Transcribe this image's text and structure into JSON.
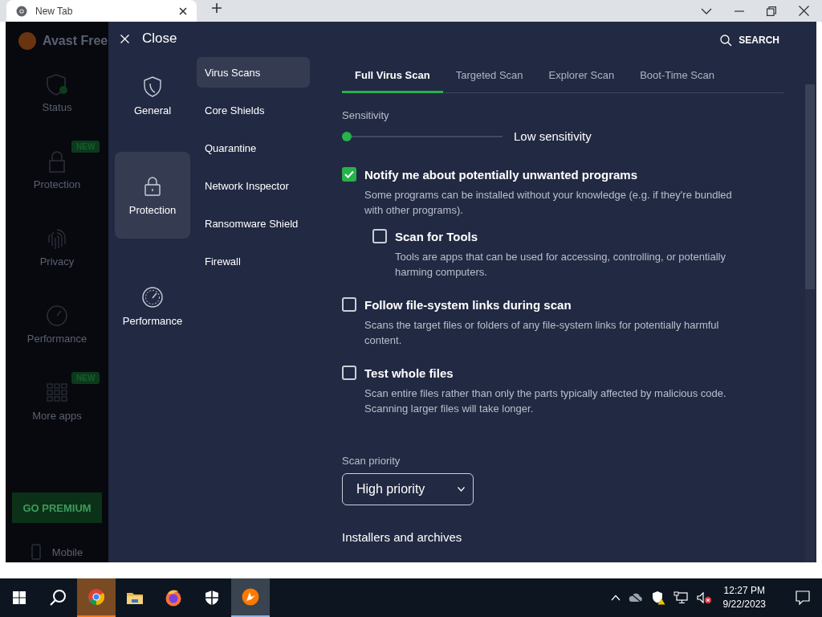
{
  "browser": {
    "tab_title": "New Tab"
  },
  "dimmed_sidebar": {
    "app_title": "Avast Free",
    "items": [
      {
        "label": "Status"
      },
      {
        "label": "Protection",
        "badge": "NEW"
      },
      {
        "label": "Privacy"
      },
      {
        "label": "Performance"
      },
      {
        "label": "More apps",
        "badge": "NEW"
      }
    ],
    "premium_button": "GO PREMIUM",
    "mobile": "Mobile"
  },
  "settings": {
    "close": "Close",
    "search": "SEARCH",
    "categories": [
      {
        "label": "General",
        "selected": false
      },
      {
        "label": "Protection",
        "selected": true
      },
      {
        "label": "Performance",
        "selected": false
      }
    ],
    "subnav": [
      {
        "label": "Virus Scans",
        "selected": true
      },
      {
        "label": "Core Shields",
        "selected": false
      },
      {
        "label": "Quarantine",
        "selected": false
      },
      {
        "label": "Network Inspector",
        "selected": false
      },
      {
        "label": "Ransomware Shield",
        "selected": false
      },
      {
        "label": "Firewall",
        "selected": false
      }
    ],
    "tabs": [
      {
        "label": "Full Virus Scan",
        "selected": true
      },
      {
        "label": "Targeted Scan",
        "selected": false
      },
      {
        "label": "Explorer Scan",
        "selected": false
      },
      {
        "label": "Boot-Time Scan",
        "selected": false
      }
    ],
    "sensitivity": {
      "label": "Sensitivity",
      "level": 0,
      "reading": "Low sensitivity"
    },
    "options": [
      {
        "label": "Notify me about potentially unwanted programs",
        "description": "Some programs can be installed without your knowledge (e.g. if they're bundled with other programs).",
        "checked": true,
        "children": [
          {
            "label": "Scan for Tools",
            "description": "Tools are apps that can be used for accessing, controlling, or potentially harming computers.",
            "checked": false
          }
        ]
      },
      {
        "label": "Follow file-system links during scan",
        "description": "Scans the target files or folders of any file-system links for potentially harmful content.",
        "checked": false
      },
      {
        "label": "Test whole files",
        "description": "Scan entire files rather than only the parts typically affected by malicious code. Scanning larger files will take longer.",
        "checked": false
      }
    ],
    "scan_priority": {
      "label": "Scan priority",
      "value": "High priority"
    },
    "section_heading": "Installers and archives"
  },
  "taskbar": {
    "time": "12:27 PM",
    "date": "9/22/2023"
  }
}
